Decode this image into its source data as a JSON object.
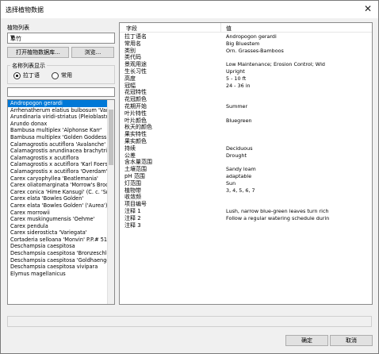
{
  "window": {
    "title": "选择植物数据",
    "close_glyph": "✕"
  },
  "left": {
    "list_label": "植物列表",
    "list_select_value": "单竹",
    "open_db_button": "打开植物数据库...",
    "browse_button": "浏览...",
    "name_display_label": "名称列表显示",
    "radio_latin": "拉丁语",
    "radio_common": "常用",
    "filter_value": "",
    "plants": [
      "Andropogon gerardi",
      "Arrhenatherum elatius bulbosum 'Varieg",
      "Arundinaria viridi-striatus (Pleioblastus v",
      "Arundo donax",
      "Bambusa multiplex 'Alphonse Karr'",
      "Bambusa multiplex 'Golden Goddess'",
      "Calamagrostis acutiflora 'Avalanche'",
      "Calamagrostis arundinacea brachytrich",
      "Calamagrostis x acutiflora",
      "Calamagrostis x acutiflora 'Karl Foerster",
      "Calamagrostis x acutiflora 'Overdam'",
      "Carex caryophyllea 'Beatlemania'",
      "Carex oliatomarginata 'Morrow's Brocade'",
      "Carex conica 'Hime Kansugi' (C. c. 'Sno",
      "Carex elata 'Bowles Golden'",
      "Carex elata 'Bowles Golden' ('Aurea')",
      "Carex morrowii",
      "Carex muskingumensis 'Oehme'",
      "Carex pendula",
      "Carex siderosticta 'Variegata'",
      "Cortaderia selloana 'Monvin' P.P.# 513",
      "Deschampsia caespitosa",
      "Deschampsia caespitosa 'Bronzeschleie",
      "Deschampsia caespitosa 'Goldhaenge'",
      "Deschampsia caespitosa vivipara",
      "Elymus magellanicus"
    ]
  },
  "detail": {
    "col_field": "字段",
    "col_value": "值",
    "rows": [
      {
        "k": "拉丁语名",
        "v": "Andropogon gerardi"
      },
      {
        "k": "常用名",
        "v": "Big Bluestem"
      },
      {
        "k": "类别",
        "v": "Orn. Grasses-Bamboos"
      },
      {
        "k": "类代码",
        "v": ""
      },
      {
        "k": "景观用途",
        "v": "Low Maintenance; Erosion Control; Wld"
      },
      {
        "k": "生长习性",
        "v": "Upright"
      },
      {
        "k": "高度",
        "v": "5 - 10 ft"
      },
      {
        "k": "冠幅",
        "v": "24 - 36 in"
      },
      {
        "k": "花冠特性",
        "v": ""
      },
      {
        "k": "花冠颜色",
        "v": ""
      },
      {
        "k": "花期开始",
        "v": "Summer"
      },
      {
        "k": "叶片特性",
        "v": ""
      },
      {
        "k": "叶片颜色",
        "v": "Bluegreen"
      },
      {
        "k": "秋天的颜色",
        "v": ""
      },
      {
        "k": "果实特性",
        "v": ""
      },
      {
        "k": "果实颜色",
        "v": ""
      },
      {
        "k": "持续",
        "v": "Deciduous"
      },
      {
        "k": "公差",
        "v": "Drought"
      },
      {
        "k": "含水量范围",
        "v": ""
      },
      {
        "k": "土壤范围",
        "v": "Sandy loam"
      },
      {
        "k": "pH 范围",
        "v": "adaptable"
      },
      {
        "k": "灯范围",
        "v": "Sun"
      },
      {
        "k": "植物带",
        "v": "3, 4, 5, 6, 7"
      },
      {
        "k": "收敛频",
        "v": ""
      },
      {
        "k": "项目编号",
        "v": ""
      },
      {
        "k": "注释 1",
        "v": "Lush, narrow blue-green leaves turn rich"
      },
      {
        "k": "注释 2",
        "v": "Follow a regular watering schedule durin"
      },
      {
        "k": "注释 3",
        "v": ""
      }
    ]
  },
  "footer": {
    "ok": "确定",
    "cancel": "取消"
  },
  "colors": {
    "selection": "#0078d7",
    "dialog_bg": "#f0f0f0"
  }
}
